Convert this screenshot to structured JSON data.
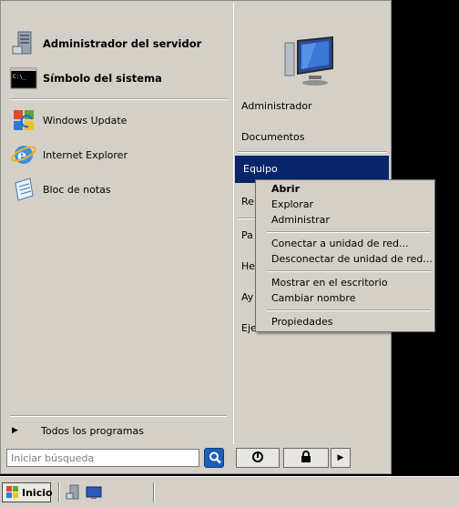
{
  "left_pane": {
    "pinned": [
      {
        "label": "Administrador del servidor",
        "icon": "server-manager-icon"
      },
      {
        "label": "Símbolo del sistema",
        "icon": "command-prompt-icon"
      }
    ],
    "recent": [
      {
        "label": "Windows Update",
        "icon": "windows-update-icon"
      },
      {
        "label": "Internet Explorer",
        "icon": "internet-explorer-icon"
      },
      {
        "label": "Bloc de notas",
        "icon": "notepad-icon"
      }
    ],
    "all_programs": "Todos los programas"
  },
  "right_pane": {
    "items": [
      {
        "label": "Administrador"
      },
      {
        "label": "Documentos"
      },
      {
        "label": "Equipo"
      },
      {
        "label": "Re"
      },
      {
        "label": "Pa"
      },
      {
        "label": "He"
      },
      {
        "label": "Ay"
      },
      {
        "label": "Eje"
      }
    ]
  },
  "context_menu": {
    "items": [
      {
        "label": "Abrir"
      },
      {
        "label": "Explorar"
      },
      {
        "label": "Administrar"
      },
      {
        "label": "Conectar a unidad de red..."
      },
      {
        "label": "Desconectar de unidad de red..."
      },
      {
        "label": "Mostrar en el escritorio"
      },
      {
        "label": "Cambiar nombre"
      },
      {
        "label": "Propiedades"
      }
    ]
  },
  "search": {
    "placeholder": "Iniciar búsqueda"
  },
  "taskbar": {
    "start_label": "Inicio"
  },
  "colors": {
    "highlight": "#0a246a",
    "menu_bg": "#d4d0c8",
    "search_btn": "#1c5fb8"
  }
}
